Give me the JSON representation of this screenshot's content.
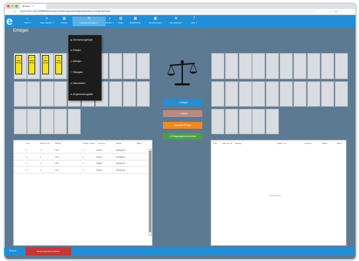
{
  "browser": {
    "tab_title": "Erfolgen – e",
    "tab_close": "×",
    "url": "Nicht sicher  |  https://WEBSEITE.de/administrationsgerate/Inhalte/standard/new-erfolgen/#erfolgen",
    "nav": [
      "←",
      "→",
      "C"
    ],
    "extensions": [
      "☆",
      "⊕",
      "⋯",
      "⋮"
    ]
  },
  "toolbar": {
    "logo": "e",
    "items": [
      {
        "icon": "⌂",
        "label": "Start ∨"
      },
      {
        "icon": "≡",
        "label": "Stammdaten ∨"
      },
      {
        "icon": "▤",
        "label": "Belege"
      },
      {
        "icon": "⟲",
        "label": "Gegenbuchungen ∨"
      },
      {
        "icon": "⌕",
        "label": "Prüfen ∨"
      },
      {
        "icon": "▥",
        "label": "Listen"
      },
      {
        "icon": "▦",
        "label": "Rückstände"
      },
      {
        "icon": "▣",
        "label": "Auswertungen"
      },
      {
        "icon": "⚙",
        "label": "Einstellungen"
      },
      {
        "icon": "?",
        "label": "Hilfe ∨"
      }
    ]
  },
  "dropdown": {
    "items": [
      {
        "icon": "▤",
        "label": "Überweisungsträger"
      },
      {
        "icon": "⊕",
        "label": "Erfolgen"
      },
      {
        "icon": "◷",
        "label": "Abfolgen"
      },
      {
        "icon": "↶",
        "label": "Rückgabe"
      },
      {
        "icon": "⛭",
        "label": "Stammdaten"
      },
      {
        "icon": "⚖",
        "label": "Gegenbuchungsliste"
      }
    ]
  },
  "page": {
    "title": "Erfolgen"
  },
  "yellow_cards": [
    {
      "num": "1",
      "line2": "0022",
      "line3": "Erfolg"
    },
    {
      "num": "2",
      "line2": "0022",
      "line3": "Erfolg"
    },
    {
      "num": "3",
      "line2": "0022",
      "line3": "Erfolg"
    },
    {
      "num": "4",
      "line2": "0022",
      "line3": "Erfolg"
    }
  ],
  "buttons": {
    "forward": "→  Erfolgen",
    "back": "←  Zurück",
    "manual": "Manuelle Erfolge",
    "print": "⎙  Erfolgsergebnis drucken"
  },
  "colors": {
    "forward": "#1e8fd8",
    "back": "#b98a84",
    "manual": "#f08a1c",
    "print": "#4aa048"
  },
  "left_table": {
    "headers": [
      "Pos",
      "Rahmen Nr.",
      "Betrag",
      "Abgelt. Leistg.",
      "Leistung",
      "Status",
      "Beleg"
    ],
    "rows": [
      [
        "1",
        "1",
        "100",
        "1",
        "Erfolg",
        "Erfolgreich",
        ""
      ],
      [
        "2",
        "1",
        "100",
        "1",
        "Erfolg",
        "Erfolgreich",
        ""
      ],
      [
        "3",
        "1",
        "100",
        "1",
        "Erfolg",
        "Erfolgreich",
        ""
      ],
      [
        "4",
        "4",
        "100",
        "1",
        "Erfolg",
        "Erfolgreich",
        ""
      ]
    ]
  },
  "right_table": {
    "headers": [
      "Pos",
      "Rahmen Nr.",
      "Betrag",
      "Abgelt. Lst.",
      "Leistung",
      "Status",
      "Beleg"
    ],
    "empty": "Keine Daten"
  },
  "bottom": {
    "left": "Erfolgen",
    "red": "Erfolg Übersicht aufrufen"
  }
}
